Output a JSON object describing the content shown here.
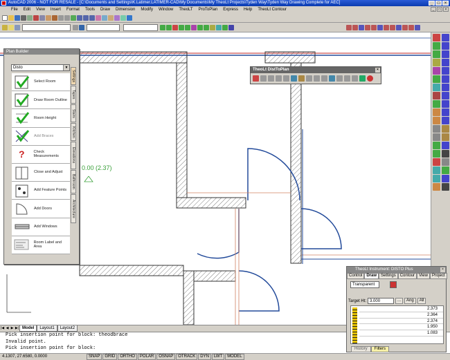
{
  "window": {
    "title": "AutoCAD 2006 - NOT FOR RESALE - [C:\\Documents and Settings\\K.Latimer.LATIMER-CAD\\My Documents\\My TheoLt Projects\\Tyden Way\\Tyden Way Drawing Complete for AEC]"
  },
  "menu": {
    "items": [
      "File",
      "Edit",
      "View",
      "Insert",
      "Format",
      "Tools",
      "Draw",
      "Dimension",
      "Modify",
      "Window",
      "TheoLT",
      "ProToPlan",
      "Express",
      "Help",
      "TheoLt Contour"
    ]
  },
  "plan_builder": {
    "title": "Plan Builder",
    "dropdown": "Disto",
    "items": [
      {
        "label": "Select Room",
        "muted": false
      },
      {
        "label": "Draw Room Outline",
        "muted": false
      },
      {
        "label": "Room Height",
        "muted": false
      },
      {
        "label": "Add Braces",
        "muted": true
      },
      {
        "label": "Check Measurements",
        "muted": false
      },
      {
        "label": "Close and Adjust",
        "muted": false
      },
      {
        "label": "Add Feature Points",
        "muted": false
      },
      {
        "label": "Add Doors",
        "muted": false
      },
      {
        "label": "Add Windows",
        "muted": false
      },
      {
        "label": "Room Label and Area",
        "muted": false
      }
    ],
    "side_tabs": [
      "Settings",
      "Tapes",
      "Stairs",
      "Kitchen",
      "Elevations",
      "Bathroom",
      "Architecture"
    ]
  },
  "distoplan": {
    "title": "TheoLt DistToPlan"
  },
  "canvas": {
    "annotation": "0.00  (2.37)"
  },
  "layout_tabs": [
    "Model",
    "Layout1",
    "Layout2"
  ],
  "command_lines": [
    "Pick insertion point for block: theodbrace",
    "Invalid point.",
    "Pick insertion point for block:"
  ],
  "status": {
    "coords": "4.1307, 27.6580, 0.0000",
    "buttons": [
      "SNAP",
      "GRID",
      "ORTHO",
      "POLAR",
      "OSNAP",
      "OTRACK",
      "DYN",
      "LWT",
      "MODEL"
    ]
  },
  "instrument": {
    "title": "TheoLt Instrument: DISTO Plus",
    "tabs": [
      "Control",
      "Draw",
      "Settings",
      "Contour",
      "View",
      "Project"
    ],
    "active_tab": "Draw",
    "mode": "Transparent",
    "target_label": "Target Ht:",
    "target_value": "3.000",
    "ang_label": "Ang",
    "all_label": "All",
    "readings": [
      "2.373",
      "2.364",
      "2.374",
      "1.950",
      "1.083"
    ],
    "bottom_tabs": [
      "History",
      "Filters"
    ],
    "active_bottom": "Filters"
  }
}
